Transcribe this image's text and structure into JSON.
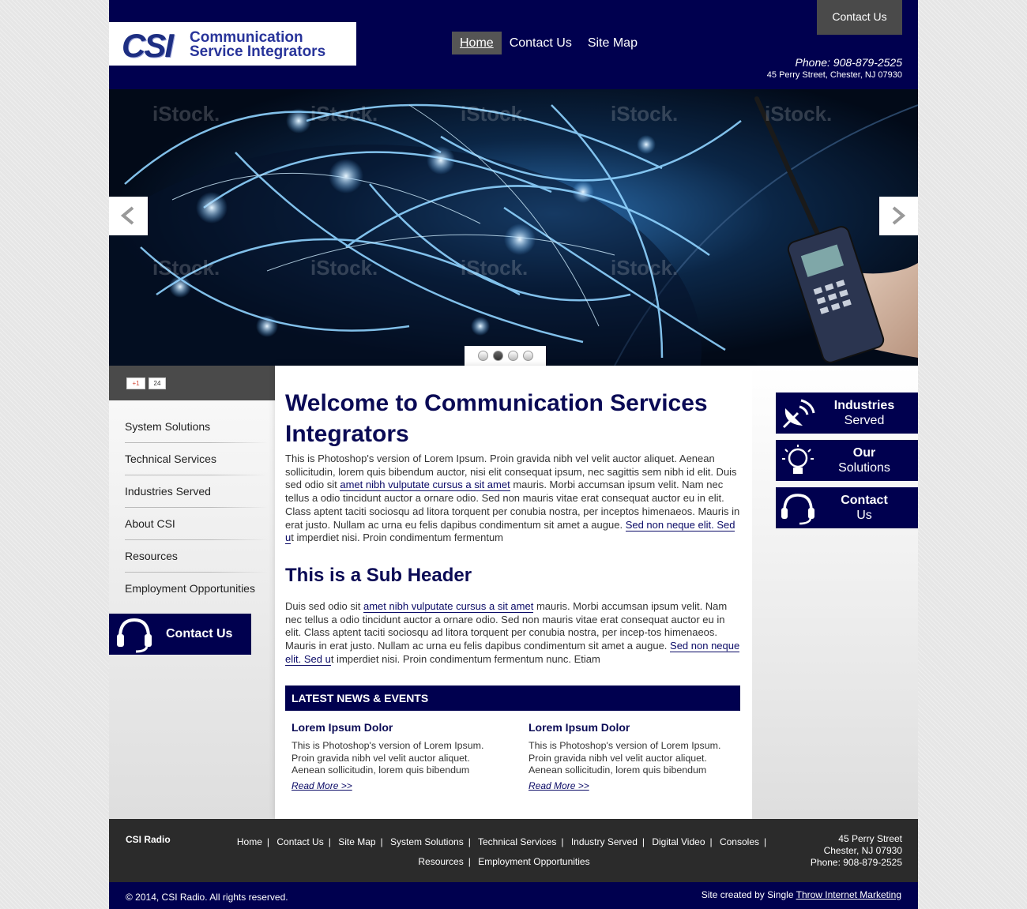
{
  "header": {
    "logo": {
      "mark": "CSI",
      "line1": "Communication",
      "line2": "Service Integrators"
    },
    "top_contact_label": "Contact Us",
    "nav": [
      {
        "label": "Home"
      },
      {
        "label": "Contact Us"
      },
      {
        "label": "Site Map"
      }
    ],
    "phone": "Phone: 908-879-2525",
    "address": "45 Perry Street, Chester, NJ 07930"
  },
  "slider": {
    "dot_count": 4,
    "active_dot": 2
  },
  "sidebar": {
    "gplus_label": "+1",
    "gplus_count": "24",
    "items": [
      {
        "label": "System Solutions"
      },
      {
        "label": "Technical Services"
      },
      {
        "label": "Industries Served"
      },
      {
        "label": "About CSI"
      },
      {
        "label": "Resources"
      },
      {
        "label": "Employment Opportunities"
      }
    ],
    "contact_label": "Contact Us"
  },
  "main": {
    "title": "Welcome to Communication Services Integrators",
    "p1_a": "This is Photoshop's version  of Lorem Ipsum. Proin gravida nibh vel velit auctor aliquet. Aenean sollicitudin, lorem quis bibendum auctor, nisi elit consequat ipsum, nec sagittis sem nibh id elit. Duis sed odio sit ",
    "p1_link1": "amet nibh vulputate cursus a sit amet",
    "p1_b": " mauris. Morbi accumsan ipsum velit. Nam nec tellus a odio tincidunt auctor a ornare odio. Sed non  mauris vitae erat consequat auctor eu in elit. Class aptent taciti sociosqu ad litora torquent per conubia nostra, per inceptos himenaeos. Mauris in erat justo. Nullam ac urna eu felis dapibus condimentum sit amet a augue. ",
    "p1_link2": "Sed non neque elit. Sed u",
    "p1_c": "t imperdiet nisi. Proin condimentum fermentum",
    "subheader": "This is a Sub Header",
    "p2_a": "Duis sed odio sit ",
    "p2_link1": "amet nibh vulputate cursus a sit amet",
    "p2_b": " mauris. Morbi accumsan ipsum velit. Nam nec tellus a odio tincidunt auctor a ornare odio. Sed non  mauris vitae erat consequat auctor eu in elit. Class aptent taciti sociosqu ad litora torquent per conubia nostra, per incep-tos himenaeos. Mauris in erat justo. Nullam ac urna eu felis dapibus condimentum sit amet a augue. ",
    "p2_link2": "Sed non neque elit. Sed u",
    "p2_c": "t imperdiet nisi. Proin condimentum fermentum nunc. Etiam",
    "news_header": "LATEST NEWS & EVENTS",
    "news": [
      {
        "title": "Lorem Ipsum Dolor",
        "text": "This is Photoshop's version  of Lorem Ipsum. Proin gravida nibh vel velit auctor aliquet. Aenean sollicitudin, lorem quis bibendum",
        "read_more": "Read More >>"
      },
      {
        "title": "Lorem Ipsum Dolor",
        "text": "This is Photoshop's version  of Lorem Ipsum. Proin gravida nibh vel velit auctor aliquet. Aenean sollicitudin, lorem quis bibendum",
        "read_more": "Read More >>"
      }
    ]
  },
  "right_buttons": [
    {
      "line1": "Industries",
      "line2": "Served",
      "icon": "satellite-dish-icon"
    },
    {
      "line1": "Our",
      "line2": "Solutions",
      "icon": "lightbulb-icon"
    },
    {
      "line1": "Contact",
      "line2": "Us",
      "icon": "headset-icon"
    }
  ],
  "footer": {
    "brand": "CSI Radio",
    "links": [
      "Home",
      "Contact Us",
      "Site Map",
      "System Solutions",
      "Technical Services",
      "Industry Served",
      "Digital Video",
      "Consoles",
      "Resources",
      "Employment Opportunities"
    ],
    "address_line1": "45 Perry Street",
    "address_line2": "Chester, NJ 07930",
    "address_line3": "Phone: 908-879-2525",
    "copyright": "© 2014, CSI Radio. All rights reserved.",
    "credit_prefix": "Site created by Single ",
    "credit_link": "Throw Internet Marketing"
  },
  "colors": {
    "navy": "#00004f",
    "dark_gray": "#4a4a4a",
    "footer_gray": "#2b2b2b"
  }
}
